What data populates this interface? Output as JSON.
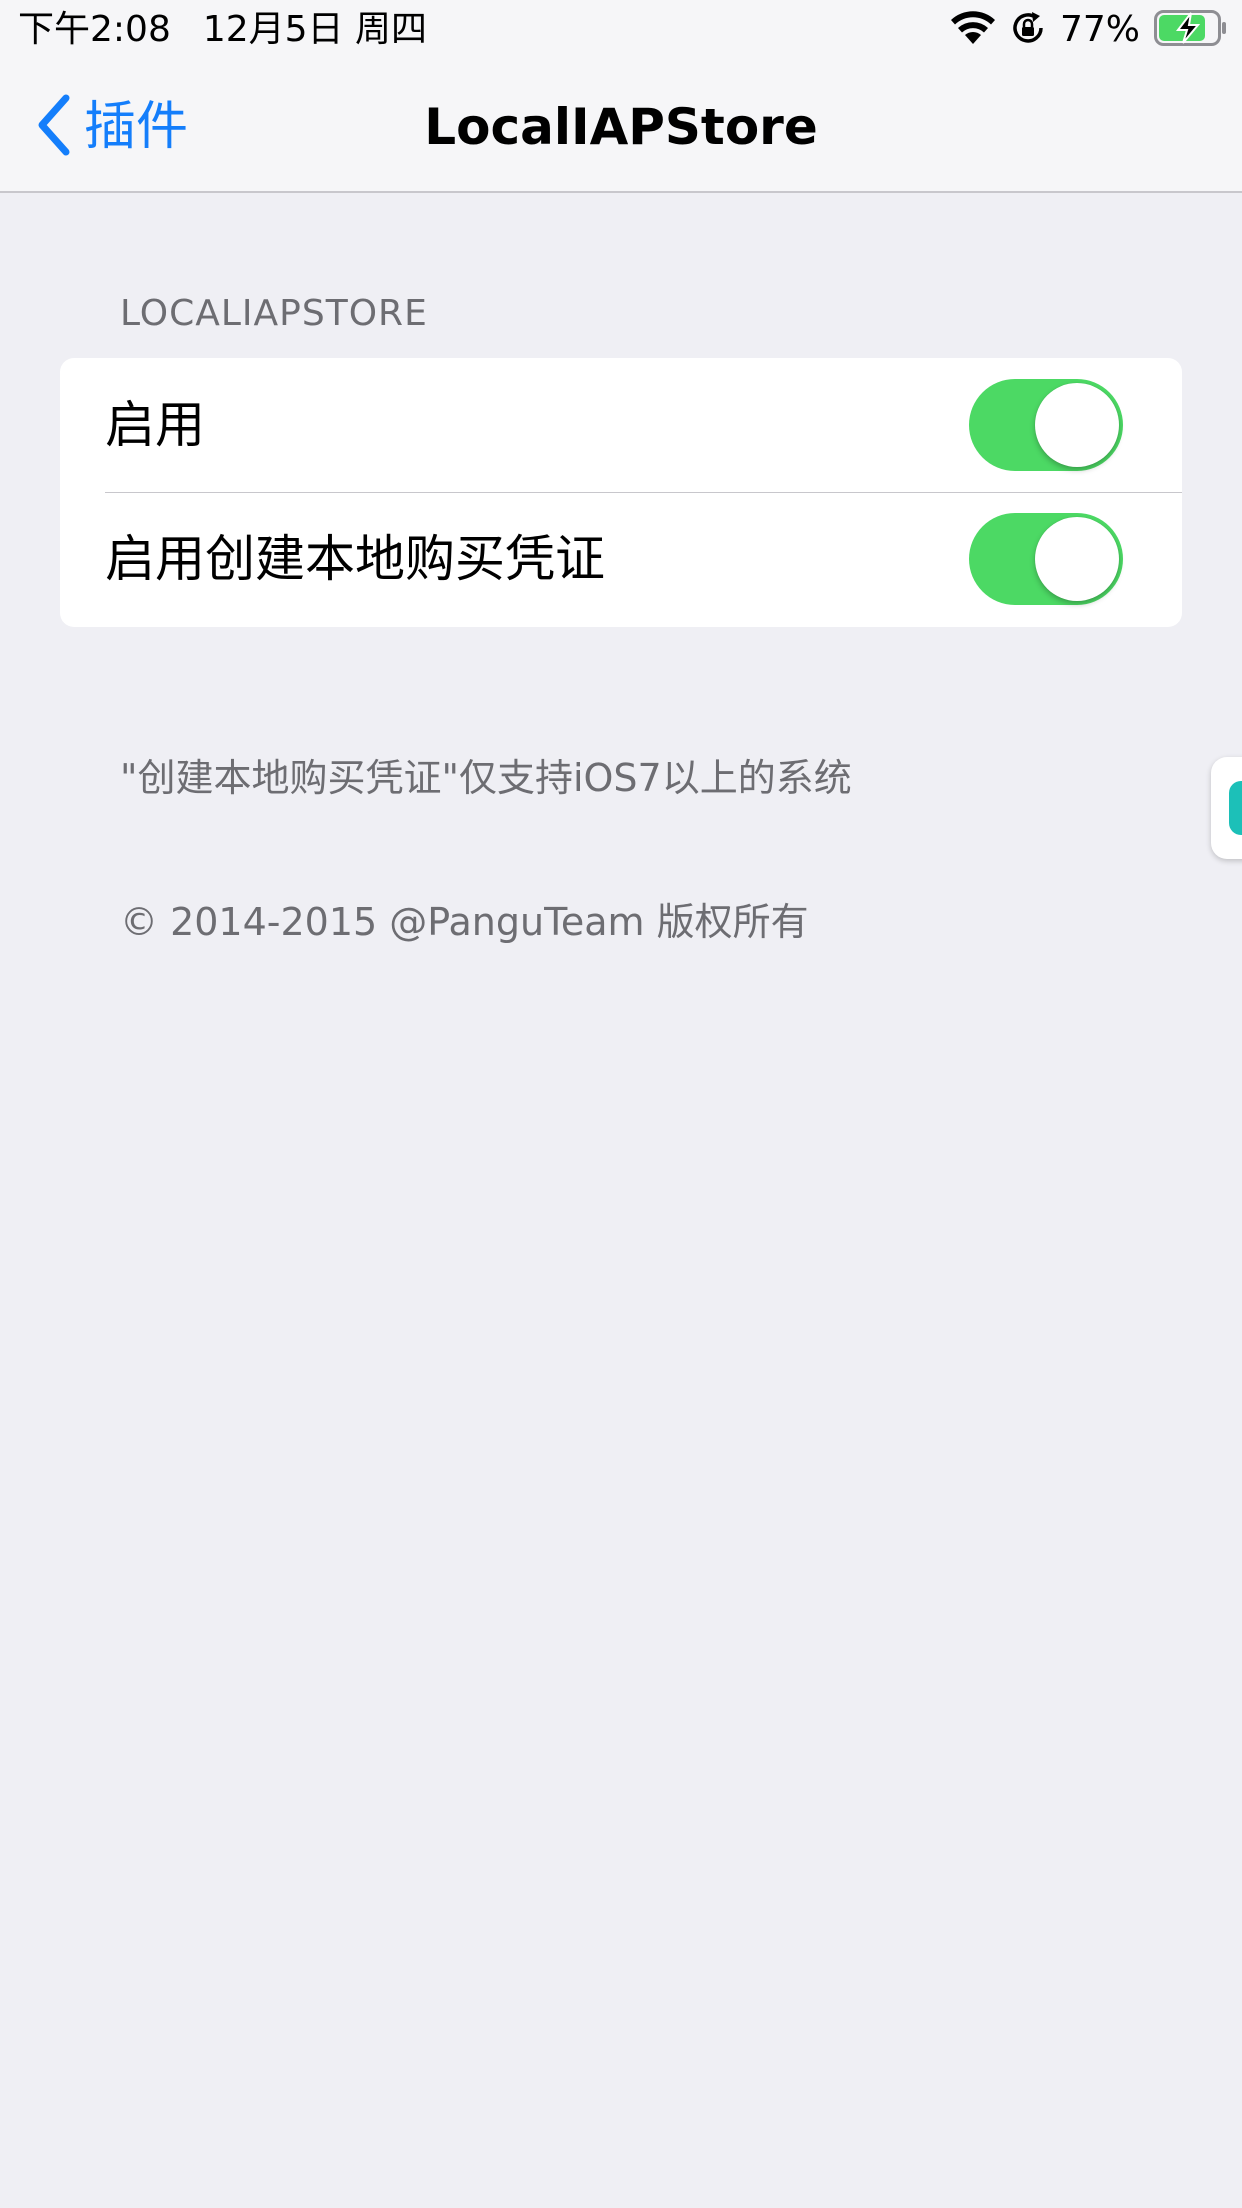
{
  "status_bar": {
    "time": "下午2:08",
    "date": "12月5日 周四",
    "battery": "77%",
    "icons": [
      "wifi-icon",
      "orientation-lock-icon",
      "battery-charging-icon"
    ]
  },
  "nav": {
    "back_label": "插件",
    "title": "LocalIAPStore"
  },
  "section": {
    "header": "LOCALIAPSTORE",
    "rows": [
      {
        "label": "启用",
        "toggle_on": true
      },
      {
        "label": "启用创建本地购买凭证",
        "toggle_on": true
      }
    ]
  },
  "footer": {
    "note": "\"创建本地购买凭证\"仅支持iOS7以上的系统",
    "copyright": "© 2014-2015 @PanguTeam 版权所有"
  },
  "colors": {
    "accent": "#147efb",
    "toggle_on": "#4cd964",
    "background": "#efeff4",
    "secondary_text": "#6d6d72"
  }
}
